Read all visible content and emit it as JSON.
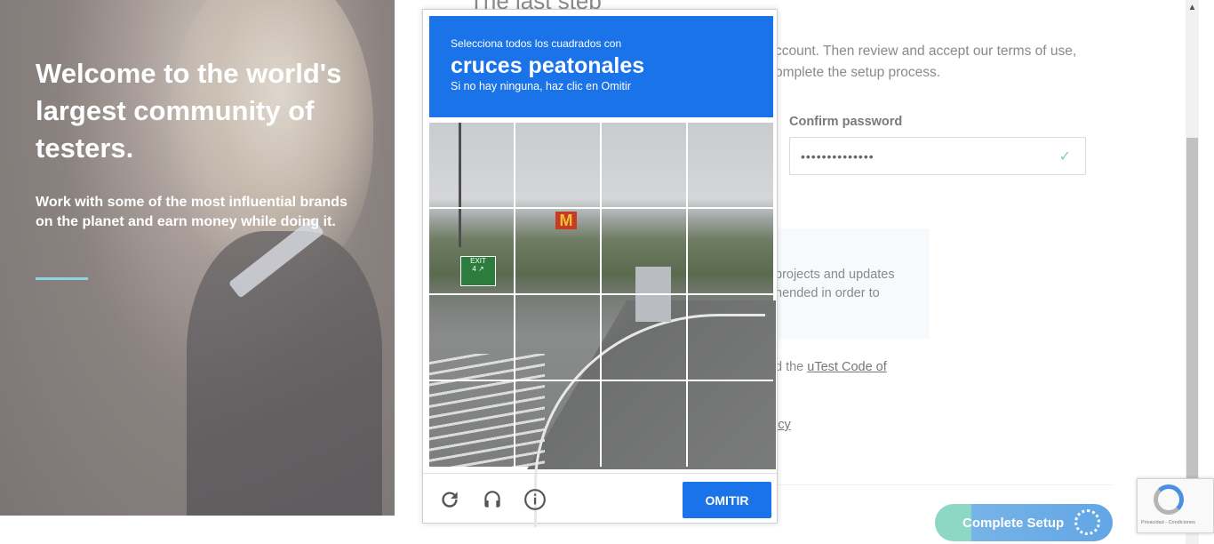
{
  "hero": {
    "title": "Welcome to the world's largest community of testers.",
    "subtitle": "Work with some of the most influential brands on the planet and earn money while doing it."
  },
  "form": {
    "step_title": "The last step",
    "intro": "ccount. Then review and accept our terms of use, omplete the setup process.",
    "confirm_label": "Confirm password",
    "confirm_value": "••••••••••••••",
    "info_text": "projects and updates nended in order to",
    "code_prefix": "d the ",
    "code_link": "uTest Code of",
    "policy_link": "icy",
    "complete_label": "Complete Setup"
  },
  "captcha": {
    "instruction": "Selecciona todos los cuadrados con",
    "target": "cruces peatonales",
    "instruction2": "Si no hay ninguna, haz clic en Omitir",
    "skip_label": "OMITIR",
    "grid_rows": 4,
    "grid_cols": 4,
    "icons": [
      "reload-icon",
      "audio-icon",
      "info-icon"
    ]
  },
  "recaptcha_badge": {
    "terms": "Privacidad - Condiciones"
  },
  "colors": {
    "captcha_blue": "#1a73e8",
    "hero_accent": "#8fd3e6",
    "complete_gradient_start": "#8dd7c6",
    "complete_gradient_end": "#62a6e6"
  }
}
